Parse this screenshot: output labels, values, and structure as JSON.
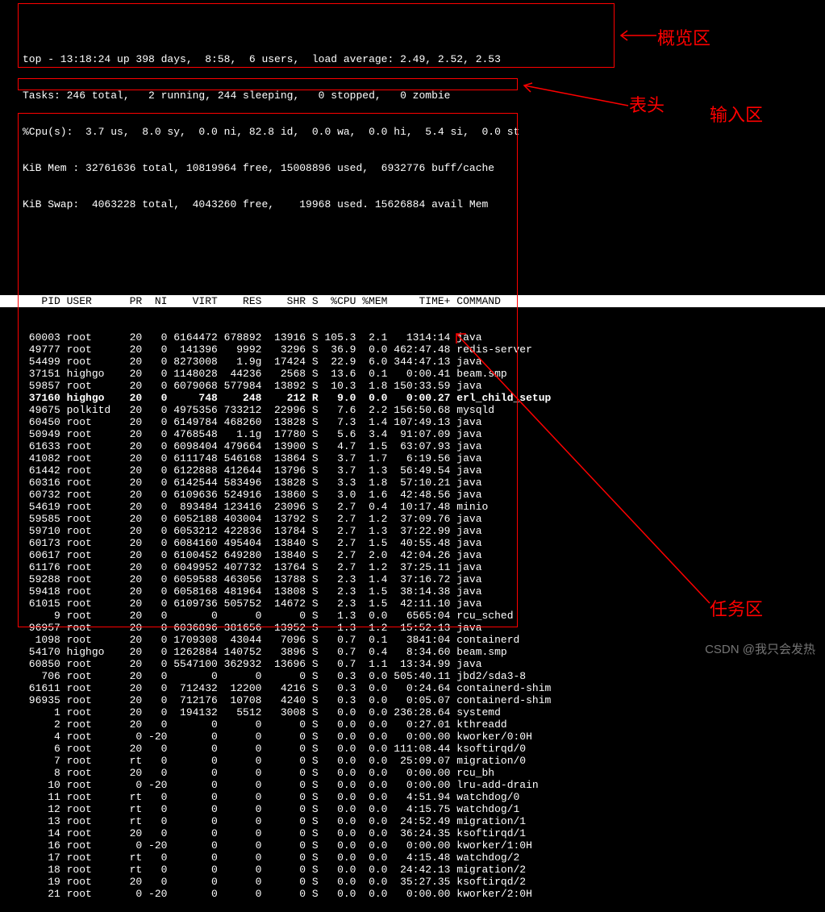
{
  "annotations": {
    "overview": "概览区",
    "header": "表头",
    "input": "输入区",
    "tasks": "任务区"
  },
  "watermark": "CSDN @我只会发热",
  "summary": {
    "line1_a": "top - 13:18:24 up 398 days,  8:58,  6 users,  load average: 2.49, 2.52, 2.53",
    "line2": "Tasks: 246 total,   2 running, 244 sleeping,   0 stopped,   0 zombie",
    "line3": "%Cpu(s):  3.7 us,  8.0 sy,  0.0 ni, 82.8 id,  0.0 wa,  0.0 hi,  5.4 si,  0.0 st",
    "line4": "KiB Mem : 32761636 total, 10819964 free, 15008896 used,  6932776 buff/cache",
    "line5": "KiB Swap:  4063228 total,  4043260 free,    19968 used. 15626884 avail Mem "
  },
  "header": "   PID USER      PR  NI    VIRT    RES    SHR S  %CPU %MEM     TIME+ COMMAND",
  "processes": [
    {
      "pid": "60003",
      "user": "root",
      "pr": "20",
      "ni": "0",
      "virt": "6164472",
      "res": "678892",
      "shr": "13916",
      "s": "S",
      "cpu": "105.3",
      "mem": "2.1",
      "time": "1314:14",
      "cmd": "java"
    },
    {
      "pid": "49777",
      "user": "root",
      "pr": "20",
      "ni": "0",
      "virt": "141396",
      "res": "9992",
      "shr": "3296",
      "s": "S",
      "cpu": "36.9",
      "mem": "0.0",
      "time": "462:47.48",
      "cmd": "redis-server"
    },
    {
      "pid": "54499",
      "user": "root",
      "pr": "20",
      "ni": "0",
      "virt": "8273008",
      "res": "1.9g",
      "shr": "17424",
      "s": "S",
      "cpu": "22.9",
      "mem": "6.0",
      "time": "344:47.13",
      "cmd": "java"
    },
    {
      "pid": "37151",
      "user": "highgo",
      "pr": "20",
      "ni": "0",
      "virt": "1148028",
      "res": "44236",
      "shr": "2568",
      "s": "S",
      "cpu": "13.6",
      "mem": "0.1",
      "time": "0:00.41",
      "cmd": "beam.smp"
    },
    {
      "pid": "59857",
      "user": "root",
      "pr": "20",
      "ni": "0",
      "virt": "6079068",
      "res": "577984",
      "shr": "13892",
      "s": "S",
      "cpu": "10.3",
      "mem": "1.8",
      "time": "150:33.59",
      "cmd": "java"
    },
    {
      "pid": "37160",
      "user": "highgo",
      "pr": "20",
      "ni": "0",
      "virt": "748",
      "res": "248",
      "shr": "212",
      "s": "R",
      "cpu": "9.0",
      "mem": "0.0",
      "time": "0:00.27",
      "cmd": "erl_child_setup",
      "bold": true
    },
    {
      "pid": "49675",
      "user": "polkitd",
      "pr": "20",
      "ni": "0",
      "virt": "4975356",
      "res": "733212",
      "shr": "22996",
      "s": "S",
      "cpu": "7.6",
      "mem": "2.2",
      "time": "156:50.68",
      "cmd": "mysqld"
    },
    {
      "pid": "60450",
      "user": "root",
      "pr": "20",
      "ni": "0",
      "virt": "6149784",
      "res": "468260",
      "shr": "13828",
      "s": "S",
      "cpu": "7.3",
      "mem": "1.4",
      "time": "107:49.13",
      "cmd": "java"
    },
    {
      "pid": "50949",
      "user": "root",
      "pr": "20",
      "ni": "0",
      "virt": "4768548",
      "res": "1.1g",
      "shr": "17780",
      "s": "S",
      "cpu": "5.6",
      "mem": "3.4",
      "time": "91:07.09",
      "cmd": "java"
    },
    {
      "pid": "61633",
      "user": "root",
      "pr": "20",
      "ni": "0",
      "virt": "6098404",
      "res": "479664",
      "shr": "13900",
      "s": "S",
      "cpu": "4.7",
      "mem": "1.5",
      "time": "63:07.93",
      "cmd": "java"
    },
    {
      "pid": "41082",
      "user": "root",
      "pr": "20",
      "ni": "0",
      "virt": "6111748",
      "res": "546168",
      "shr": "13864",
      "s": "S",
      "cpu": "3.7",
      "mem": "1.7",
      "time": "6:19.56",
      "cmd": "java"
    },
    {
      "pid": "61442",
      "user": "root",
      "pr": "20",
      "ni": "0",
      "virt": "6122888",
      "res": "412644",
      "shr": "13796",
      "s": "S",
      "cpu": "3.7",
      "mem": "1.3",
      "time": "56:49.54",
      "cmd": "java"
    },
    {
      "pid": "60316",
      "user": "root",
      "pr": "20",
      "ni": "0",
      "virt": "6142544",
      "res": "583496",
      "shr": "13828",
      "s": "S",
      "cpu": "3.3",
      "mem": "1.8",
      "time": "57:10.21",
      "cmd": "java"
    },
    {
      "pid": "60732",
      "user": "root",
      "pr": "20",
      "ni": "0",
      "virt": "6109636",
      "res": "524916",
      "shr": "13860",
      "s": "S",
      "cpu": "3.0",
      "mem": "1.6",
      "time": "42:48.56",
      "cmd": "java"
    },
    {
      "pid": "54619",
      "user": "root",
      "pr": "20",
      "ni": "0",
      "virt": "893484",
      "res": "123416",
      "shr": "23096",
      "s": "S",
      "cpu": "2.7",
      "mem": "0.4",
      "time": "10:17.48",
      "cmd": "minio"
    },
    {
      "pid": "59585",
      "user": "root",
      "pr": "20",
      "ni": "0",
      "virt": "6052188",
      "res": "403004",
      "shr": "13792",
      "s": "S",
      "cpu": "2.7",
      "mem": "1.2",
      "time": "37:09.76",
      "cmd": "java"
    },
    {
      "pid": "59710",
      "user": "root",
      "pr": "20",
      "ni": "0",
      "virt": "6053212",
      "res": "422836",
      "shr": "13784",
      "s": "S",
      "cpu": "2.7",
      "mem": "1.3",
      "time": "37:22.99",
      "cmd": "java"
    },
    {
      "pid": "60173",
      "user": "root",
      "pr": "20",
      "ni": "0",
      "virt": "6084160",
      "res": "495404",
      "shr": "13840",
      "s": "S",
      "cpu": "2.7",
      "mem": "1.5",
      "time": "40:55.48",
      "cmd": "java"
    },
    {
      "pid": "60617",
      "user": "root",
      "pr": "20",
      "ni": "0",
      "virt": "6100452",
      "res": "649280",
      "shr": "13840",
      "s": "S",
      "cpu": "2.7",
      "mem": "2.0",
      "time": "42:04.26",
      "cmd": "java"
    },
    {
      "pid": "61176",
      "user": "root",
      "pr": "20",
      "ni": "0",
      "virt": "6049952",
      "res": "407732",
      "shr": "13764",
      "s": "S",
      "cpu": "2.7",
      "mem": "1.2",
      "time": "37:25.11",
      "cmd": "java"
    },
    {
      "pid": "59288",
      "user": "root",
      "pr": "20",
      "ni": "0",
      "virt": "6059588",
      "res": "463056",
      "shr": "13788",
      "s": "S",
      "cpu": "2.3",
      "mem": "1.4",
      "time": "37:16.72",
      "cmd": "java"
    },
    {
      "pid": "59418",
      "user": "root",
      "pr": "20",
      "ni": "0",
      "virt": "6058168",
      "res": "481964",
      "shr": "13808",
      "s": "S",
      "cpu": "2.3",
      "mem": "1.5",
      "time": "38:14.38",
      "cmd": "java"
    },
    {
      "pid": "61015",
      "user": "root",
      "pr": "20",
      "ni": "0",
      "virt": "6109736",
      "res": "505752",
      "shr": "14672",
      "s": "S",
      "cpu": "2.3",
      "mem": "1.5",
      "time": "42:11.10",
      "cmd": "java"
    },
    {
      "pid": "9",
      "user": "root",
      "pr": "20",
      "ni": "0",
      "virt": "0",
      "res": "0",
      "shr": "0",
      "s": "S",
      "cpu": "1.3",
      "mem": "0.0",
      "time": "6565:04",
      "cmd": "rcu_sched"
    },
    {
      "pid": "96957",
      "user": "root",
      "pr": "20",
      "ni": "0",
      "virt": "6036896",
      "res": "381656",
      "shr": "13952",
      "s": "S",
      "cpu": "1.3",
      "mem": "1.2",
      "time": "15:52.13",
      "cmd": "java"
    },
    {
      "pid": "1098",
      "user": "root",
      "pr": "20",
      "ni": "0",
      "virt": "1709308",
      "res": "43044",
      "shr": "7096",
      "s": "S",
      "cpu": "0.7",
      "mem": "0.1",
      "time": "3841:04",
      "cmd": "containerd"
    },
    {
      "pid": "54170",
      "user": "highgo",
      "pr": "20",
      "ni": "0",
      "virt": "1262884",
      "res": "140752",
      "shr": "3896",
      "s": "S",
      "cpu": "0.7",
      "mem": "0.4",
      "time": "8:34.60",
      "cmd": "beam.smp"
    },
    {
      "pid": "60850",
      "user": "root",
      "pr": "20",
      "ni": "0",
      "virt": "5547100",
      "res": "362932",
      "shr": "13696",
      "s": "S",
      "cpu": "0.7",
      "mem": "1.1",
      "time": "13:34.99",
      "cmd": "java"
    },
    {
      "pid": "706",
      "user": "root",
      "pr": "20",
      "ni": "0",
      "virt": "0",
      "res": "0",
      "shr": "0",
      "s": "S",
      "cpu": "0.3",
      "mem": "0.0",
      "time": "505:40.11",
      "cmd": "jbd2/sda3-8"
    },
    {
      "pid": "61611",
      "user": "root",
      "pr": "20",
      "ni": "0",
      "virt": "712432",
      "res": "12200",
      "shr": "4216",
      "s": "S",
      "cpu": "0.3",
      "mem": "0.0",
      "time": "0:24.64",
      "cmd": "containerd-shim"
    },
    {
      "pid": "96935",
      "user": "root",
      "pr": "20",
      "ni": "0",
      "virt": "712176",
      "res": "10708",
      "shr": "4240",
      "s": "S",
      "cpu": "0.3",
      "mem": "0.0",
      "time": "0:05.07",
      "cmd": "containerd-shim"
    },
    {
      "pid": "1",
      "user": "root",
      "pr": "20",
      "ni": "0",
      "virt": "194132",
      "res": "5512",
      "shr": "3008",
      "s": "S",
      "cpu": "0.0",
      "mem": "0.0",
      "time": "236:28.64",
      "cmd": "systemd"
    },
    {
      "pid": "2",
      "user": "root",
      "pr": "20",
      "ni": "0",
      "virt": "0",
      "res": "0",
      "shr": "0",
      "s": "S",
      "cpu": "0.0",
      "mem": "0.0",
      "time": "0:27.01",
      "cmd": "kthreadd"
    },
    {
      "pid": "4",
      "user": "root",
      "pr": "0",
      "ni": "-20",
      "virt": "0",
      "res": "0",
      "shr": "0",
      "s": "S",
      "cpu": "0.0",
      "mem": "0.0",
      "time": "0:00.00",
      "cmd": "kworker/0:0H"
    },
    {
      "pid": "6",
      "user": "root",
      "pr": "20",
      "ni": "0",
      "virt": "0",
      "res": "0",
      "shr": "0",
      "s": "S",
      "cpu": "0.0",
      "mem": "0.0",
      "time": "111:08.44",
      "cmd": "ksoftirqd/0"
    },
    {
      "pid": "7",
      "user": "root",
      "pr": "rt",
      "ni": "0",
      "virt": "0",
      "res": "0",
      "shr": "0",
      "s": "S",
      "cpu": "0.0",
      "mem": "0.0",
      "time": "25:09.07",
      "cmd": "migration/0"
    },
    {
      "pid": "8",
      "user": "root",
      "pr": "20",
      "ni": "0",
      "virt": "0",
      "res": "0",
      "shr": "0",
      "s": "S",
      "cpu": "0.0",
      "mem": "0.0",
      "time": "0:00.00",
      "cmd": "rcu_bh"
    },
    {
      "pid": "10",
      "user": "root",
      "pr": "0",
      "ni": "-20",
      "virt": "0",
      "res": "0",
      "shr": "0",
      "s": "S",
      "cpu": "0.0",
      "mem": "0.0",
      "time": "0:00.00",
      "cmd": "lru-add-drain"
    },
    {
      "pid": "11",
      "user": "root",
      "pr": "rt",
      "ni": "0",
      "virt": "0",
      "res": "0",
      "shr": "0",
      "s": "S",
      "cpu": "0.0",
      "mem": "0.0",
      "time": "4:51.94",
      "cmd": "watchdog/0"
    },
    {
      "pid": "12",
      "user": "root",
      "pr": "rt",
      "ni": "0",
      "virt": "0",
      "res": "0",
      "shr": "0",
      "s": "S",
      "cpu": "0.0",
      "mem": "0.0",
      "time": "4:15.75",
      "cmd": "watchdog/1"
    },
    {
      "pid": "13",
      "user": "root",
      "pr": "rt",
      "ni": "0",
      "virt": "0",
      "res": "0",
      "shr": "0",
      "s": "S",
      "cpu": "0.0",
      "mem": "0.0",
      "time": "24:52.49",
      "cmd": "migration/1"
    },
    {
      "pid": "14",
      "user": "root",
      "pr": "20",
      "ni": "0",
      "virt": "0",
      "res": "0",
      "shr": "0",
      "s": "S",
      "cpu": "0.0",
      "mem": "0.0",
      "time": "36:24.35",
      "cmd": "ksoftirqd/1"
    },
    {
      "pid": "16",
      "user": "root",
      "pr": "0",
      "ni": "-20",
      "virt": "0",
      "res": "0",
      "shr": "0",
      "s": "S",
      "cpu": "0.0",
      "mem": "0.0",
      "time": "0:00.00",
      "cmd": "kworker/1:0H"
    },
    {
      "pid": "17",
      "user": "root",
      "pr": "rt",
      "ni": "0",
      "virt": "0",
      "res": "0",
      "shr": "0",
      "s": "S",
      "cpu": "0.0",
      "mem": "0.0",
      "time": "4:15.48",
      "cmd": "watchdog/2"
    },
    {
      "pid": "18",
      "user": "root",
      "pr": "rt",
      "ni": "0",
      "virt": "0",
      "res": "0",
      "shr": "0",
      "s": "S",
      "cpu": "0.0",
      "mem": "0.0",
      "time": "24:42.13",
      "cmd": "migration/2"
    },
    {
      "pid": "19",
      "user": "root",
      "pr": "20",
      "ni": "0",
      "virt": "0",
      "res": "0",
      "shr": "0",
      "s": "S",
      "cpu": "0.0",
      "mem": "0.0",
      "time": "35:27.35",
      "cmd": "ksoftirqd/2"
    },
    {
      "pid": "21",
      "user": "root",
      "pr": "0",
      "ni": "-20",
      "virt": "0",
      "res": "0",
      "shr": "0",
      "s": "S",
      "cpu": "0.0",
      "mem": "0.0",
      "time": "0:00.00",
      "cmd": "kworker/2:0H"
    }
  ]
}
